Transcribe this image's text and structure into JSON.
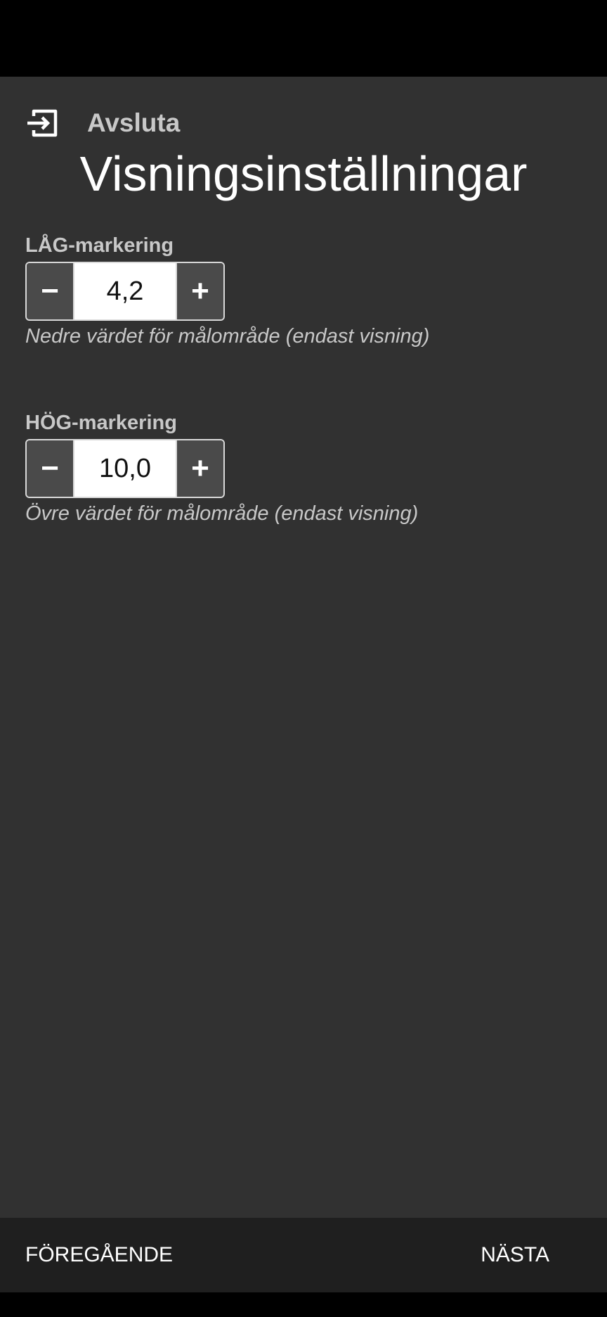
{
  "header": {
    "exit_label": "Avsluta",
    "exit_icon": "exit-arrow-icon",
    "title": "Visningsinställningar"
  },
  "settings": [
    {
      "label": "LÅG-markering",
      "value": "4,2",
      "decrement": "−",
      "increment": "+",
      "help": "Nedre värdet för målområde (endast visning)"
    },
    {
      "label": "HÖG-markering",
      "value": "10,0",
      "decrement": "−",
      "increment": "+",
      "help": "Övre värdet för målområde (endast visning)"
    }
  ],
  "footer": {
    "prev_label": "FÖREGÅENDE",
    "next_label": "NÄSTA"
  },
  "colors": {
    "background": "#313131",
    "footer": "#1f1f1f",
    "text_primary": "#ffffff",
    "text_secondary": "#c8c8c8",
    "stepper_button": "#4a4a4a"
  }
}
